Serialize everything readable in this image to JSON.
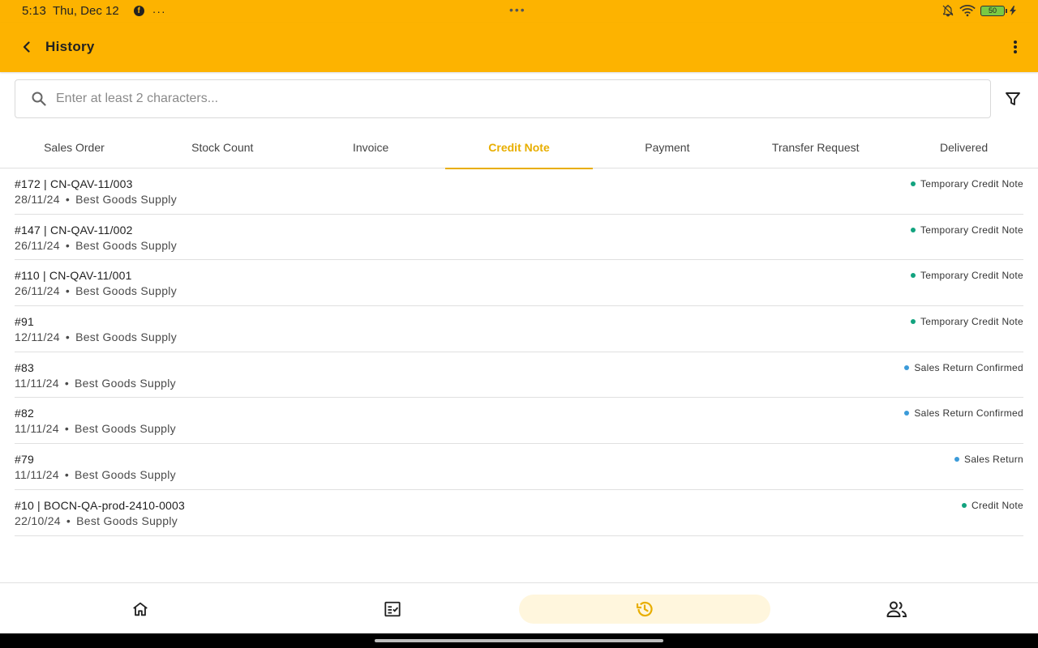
{
  "status_bar": {
    "time": "5:13",
    "date": "Thu, Dec 12",
    "more_indicator": "···",
    "center_indicator": "•••",
    "battery_level": "50"
  },
  "app_bar": {
    "title": "History"
  },
  "search": {
    "placeholder": "Enter at least 2 characters..."
  },
  "tabs": [
    {
      "label": "Sales Order"
    },
    {
      "label": "Stock Count"
    },
    {
      "label": "Invoice"
    },
    {
      "label": "Credit Note"
    },
    {
      "label": "Payment"
    },
    {
      "label": "Transfer Request"
    },
    {
      "label": "Delivered"
    }
  ],
  "active_tab": "Credit Note",
  "colors": {
    "brand": "#FDB300",
    "active_tab": "#E8AE00",
    "status_green": "#12A37F",
    "status_blue": "#3B9BD9"
  },
  "records": [
    {
      "title": "#172 | CN-QAV-11/003",
      "date": "28/11/24",
      "separator": "•",
      "customer": "Best Goods Supply",
      "status": "Temporary Credit Note",
      "status_color": "#12A37F"
    },
    {
      "title": "#147 | CN-QAV-11/002",
      "date": "26/11/24",
      "separator": "•",
      "customer": "Best Goods Supply",
      "status": "Temporary Credit Note",
      "status_color": "#12A37F"
    },
    {
      "title": "#110 | CN-QAV-11/001",
      "date": "26/11/24",
      "separator": "•",
      "customer": "Best Goods Supply",
      "status": "Temporary Credit Note",
      "status_color": "#12A37F"
    },
    {
      "title": "#91",
      "date": "12/11/24",
      "separator": "•",
      "customer": "Best Goods Supply",
      "status": "Temporary Credit Note",
      "status_color": "#12A37F"
    },
    {
      "title": "#83",
      "date": "11/11/24",
      "separator": "•",
      "customer": "Best Goods Supply",
      "status": "Sales Return Confirmed",
      "status_color": "#3B9BD9"
    },
    {
      "title": "#82",
      "date": "11/11/24",
      "separator": "•",
      "customer": "Best Goods Supply",
      "status": "Sales Return Confirmed",
      "status_color": "#3B9BD9"
    },
    {
      "title": "#79",
      "date": "11/11/24",
      "separator": "•",
      "customer": "Best Goods Supply",
      "status": "Sales Return",
      "status_color": "#3B9BD9"
    },
    {
      "title": "#10 | BOCN-QA-prod-2410-0003",
      "date": "22/10/24",
      "separator": "•",
      "customer": "Best Goods Supply",
      "status": "Credit Note",
      "status_color": "#12A37F"
    }
  ],
  "bottom_nav": [
    {
      "icon": "home-icon",
      "active": false
    },
    {
      "icon": "checklist-icon",
      "active": false
    },
    {
      "icon": "history-icon",
      "active": true
    },
    {
      "icon": "people-icon",
      "active": false
    }
  ]
}
